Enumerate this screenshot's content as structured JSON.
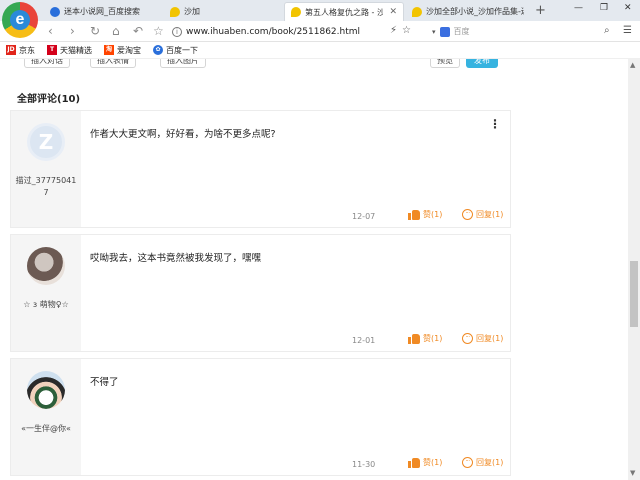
{
  "tabs": [
    {
      "title": "迷本小说网_百度搜索",
      "icon": "paw-icon",
      "active": false
    },
    {
      "title": "沙加",
      "icon": "speech-bubble-icon",
      "active": false
    },
    {
      "title": "第五人格复仇之路 - 沙加",
      "icon": "speech-bubble-icon",
      "active": true
    },
    {
      "title": "沙加全部小说_沙加作品集-迷",
      "icon": "speech-bubble-icon",
      "active": false
    }
  ],
  "address_bar": {
    "url": "www.ihuaben.com/book/2511862.html"
  },
  "search": {
    "placeholder": "百度"
  },
  "bookmarks": [
    {
      "label": "京东",
      "icon": "jd-icon",
      "color": "#e1251b"
    },
    {
      "label": "天猫精选",
      "icon": "tmall-icon",
      "color": "#d4001a"
    },
    {
      "label": "爱淘宝",
      "icon": "taobao-icon",
      "color": "#ff4400"
    },
    {
      "label": "百度一下",
      "icon": "baidu-paw-icon",
      "color": "#2a6fdb"
    }
  ],
  "toolbar": {
    "insert_dialog": "插入对话",
    "insert_emoji": "插入表情",
    "insert_image": "插入图片",
    "preview": "预览",
    "publish": "发布"
  },
  "comments_title": "全部评论(10)",
  "comments": [
    {
      "user": "描过_377750417",
      "text": "作者大大更文啊，好好看，为啥不更多点呢?",
      "date": "12-07",
      "like": "赞(1)",
      "reply": "回复(1)"
    },
    {
      "user": "☆ ɜ 萌物♀☆",
      "text": "哎呦我去，这本书竟然被我发现了，嘿嘿",
      "date": "12-01",
      "like": "赞(1)",
      "reply": "回复(1)"
    },
    {
      "user": "«一生伴@你«",
      "text": "不得了",
      "date": "11-30",
      "like": "赞(1)",
      "reply": "回复(1)"
    }
  ],
  "colors": {
    "accent": "#f08a24",
    "publish": "#36b3e0"
  }
}
